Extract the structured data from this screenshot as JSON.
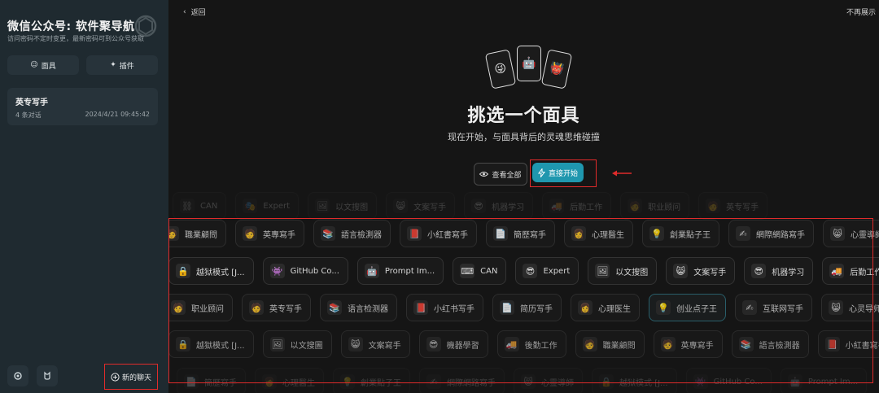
{
  "sidebar": {
    "title": "微信公众号: 软件聚导航",
    "subtitle": "访问密码不定时变更，最新密码可到公众号获取",
    "mask_button": "面具",
    "plugin_button": "插件",
    "conversation": {
      "title": "英专写手",
      "count": "4 条对话",
      "date": "2024/4/21 09:45:42"
    },
    "new_chat": "新的聊天"
  },
  "main": {
    "back": "返回",
    "no_show": "不再展示",
    "cards": [
      "😜",
      "🤖",
      "👹"
    ],
    "title": "挑选一个面具",
    "subtitle": "现在开始，与面具背后的灵魂思维碰撞",
    "view_all": "查看全部",
    "start": "直接开始"
  },
  "rows": [
    [
      {
        "e": "⛓",
        "t": "CAN"
      },
      {
        "e": "🎭",
        "t": "Expert"
      },
      {
        "e": "🖼",
        "t": "以文搜图"
      },
      {
        "e": "😸",
        "t": "文案写手"
      },
      {
        "e": "😎",
        "t": "机器学习"
      },
      {
        "e": "🚚",
        "t": "后勤工作"
      },
      {
        "e": "🧑",
        "t": "职业顾问"
      },
      {
        "e": "🧑",
        "t": "英专写手"
      }
    ],
    [
      {
        "e": "🧑",
        "t": "職業顧問"
      },
      {
        "e": "🧑",
        "t": "英專寫手"
      },
      {
        "e": "📚",
        "t": "語言檢測器"
      },
      {
        "e": "📕",
        "t": "小紅書寫手"
      },
      {
        "e": "📄",
        "t": "簡歷寫手"
      },
      {
        "e": "👩",
        "t": "心理醫生"
      },
      {
        "e": "💡",
        "t": "創業點子王"
      },
      {
        "e": "✍",
        "t": "網際網路寫手"
      },
      {
        "e": "😸",
        "t": "心靈導師"
      }
    ],
    [
      {
        "e": "🔒",
        "t": "越狱模式 [J..."
      },
      {
        "e": "👾",
        "t": "GitHub Co..."
      },
      {
        "e": "🤖",
        "t": "Prompt Im..."
      },
      {
        "e": "⌨",
        "t": "CAN"
      },
      {
        "e": "😎",
        "t": "Expert"
      },
      {
        "e": "🖼",
        "t": "以文搜图"
      },
      {
        "e": "😸",
        "t": "文案写手"
      },
      {
        "e": "😎",
        "t": "机器学习"
      },
      {
        "e": "🚚",
        "t": "后勤工作"
      }
    ],
    [
      {
        "e": "🧑",
        "t": "职业顾问"
      },
      {
        "e": "🧑",
        "t": "英专写手"
      },
      {
        "e": "📚",
        "t": "语言检测器"
      },
      {
        "e": "📕",
        "t": "小红书写手"
      },
      {
        "e": "📄",
        "t": "简历写手"
      },
      {
        "e": "👩",
        "t": "心理医生"
      },
      {
        "e": "💡",
        "t": "创业点子王"
      },
      {
        "e": "✍",
        "t": "互联网写手"
      },
      {
        "e": "😸",
        "t": "心灵导师"
      }
    ],
    [
      {
        "e": "🔒",
        "t": "越獄模式 [J..."
      },
      {
        "e": "🖼",
        "t": "以文搜圖"
      },
      {
        "e": "😸",
        "t": "文案寫手"
      },
      {
        "e": "😎",
        "t": "機器學習"
      },
      {
        "e": "🚚",
        "t": "後勤工作"
      },
      {
        "e": "🧑",
        "t": "職業顧問"
      },
      {
        "e": "🧑",
        "t": "英專寫手"
      },
      {
        "e": "📚",
        "t": "語言檢測器"
      },
      {
        "e": "📕",
        "t": "小紅書寫手"
      }
    ],
    [
      {
        "e": "📄",
        "t": "簡歷寫手"
      },
      {
        "e": "👩",
        "t": "心理醫生"
      },
      {
        "e": "💡",
        "t": "創業點子王"
      },
      {
        "e": "✍",
        "t": "網際網路寫手"
      },
      {
        "e": "😸",
        "t": "心靈導師"
      },
      {
        "e": "🔒",
        "t": "越狱模式 [J..."
      },
      {
        "e": "👾",
        "t": "GitHub Co..."
      },
      {
        "e": "🤖",
        "t": "Prompt Im..."
      }
    ]
  ],
  "colors": {
    "accent": "#1f97ae",
    "highlight_box": "#e02b2b",
    "sidebar_bg": "#1f2a30"
  }
}
